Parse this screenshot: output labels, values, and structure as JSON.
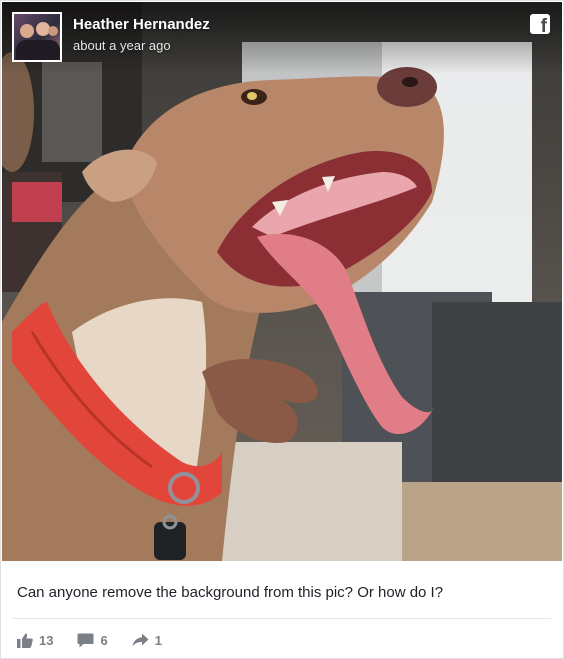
{
  "post": {
    "author": "Heather Hernandez",
    "timestamp": "about a year ago",
    "caption": "Can anyone remove the background from this pic? Or how do I?",
    "platform_icon": "facebook-icon",
    "photo_subject": "dog-photo"
  },
  "stats": {
    "likes": "13",
    "comments": "6",
    "shares": "1"
  },
  "icons": {
    "like": "thumbs-up-icon",
    "comment": "comment-icon",
    "share": "share-arrow-icon"
  },
  "colors": {
    "stat_text": "#7a7f88",
    "collar": "#e2463a",
    "tongue": "#e07d87"
  }
}
